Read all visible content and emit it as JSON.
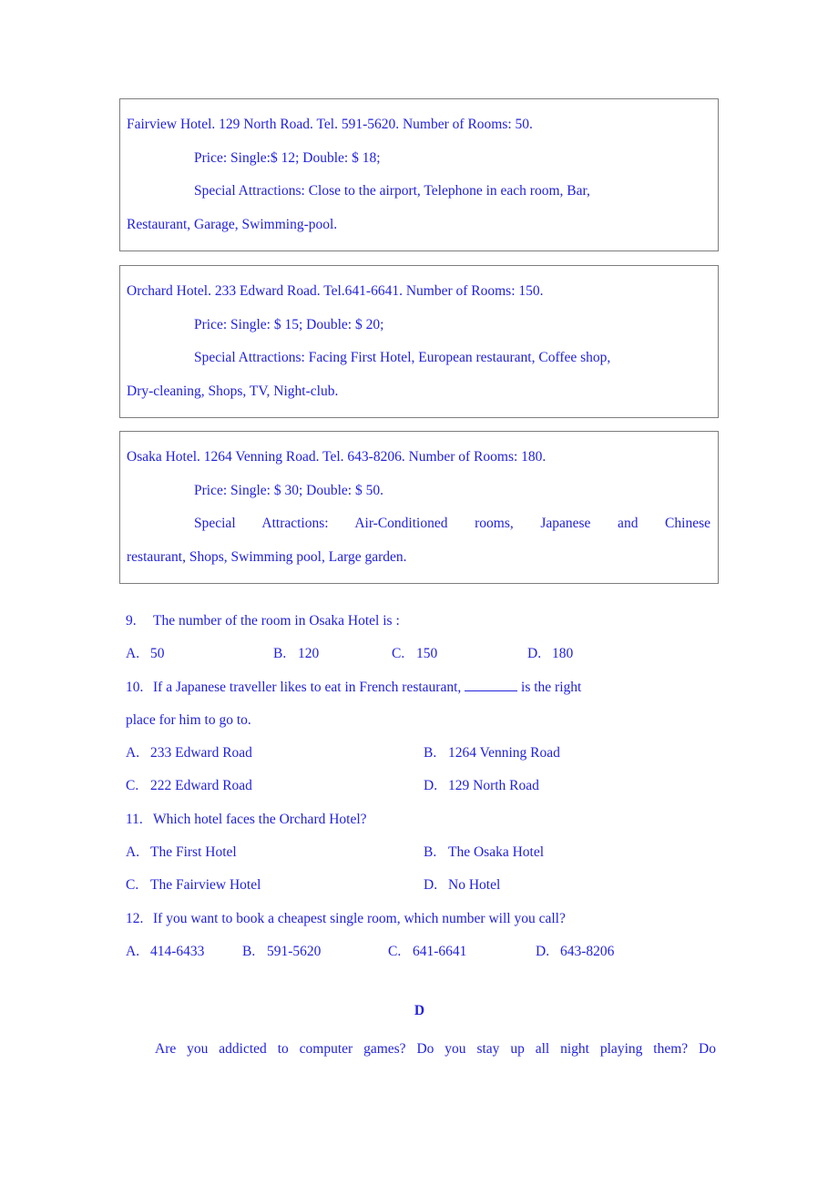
{
  "document": {
    "text_color": "#2222dd",
    "border_color": "#7d7d7d",
    "background": "#ffffff"
  },
  "hotel_boxes": [
    {
      "header": "Fairview Hotel. 129 North Road. Tel. 591-5620. Number of Rooms: 50.",
      "price_line": "Price:    Single:$ 12; Double: $ 18;",
      "attractions_head": "Special Attractions: Close to the airport, Telephone in each room, Bar,",
      "attractions_tail": "Restaurant, Garage, Swimming-pool."
    },
    {
      "header": "Orchard Hotel. 233 Edward Road. Tel.641-6641. Number of Rooms: 150.",
      "price_line": "Price:    Single: $ 15;  Double: $ 20;",
      "attractions_head": "Special Attractions: Facing First Hotel, European restaurant, Coffee shop,",
      "attractions_tail": "Dry-cleaning, Shops, TV, Night-club."
    },
    {
      "header": "Osaka Hotel. 1264 Venning Road. Tel. 643-8206. Number of Rooms: 180.",
      "price_line": "Price:    Single: $ 30;  Double: $ 50.",
      "attractions_head": "Special Attractions: Air-Conditioned rooms, Japanese and Chinese",
      "attractions_tail": "restaurant, Shops, Swimming pool, Large garden."
    }
  ],
  "questions": {
    "q9": {
      "number": "9.",
      "stem": "The number of the room in Osaka Hotel is :",
      "options": [
        {
          "label": "A.",
          "text": "50"
        },
        {
          "label": "B.",
          "text": "120"
        },
        {
          "label": "C.",
          "text": "150"
        },
        {
          "label": "D.",
          "text": "180"
        }
      ]
    },
    "q10": {
      "number": "10.",
      "stem_before_blank": "If a Japanese traveller likes to eat in French restaurant,",
      "stem_after_blank": "is the right",
      "stem_continued": "place for him to go to.",
      "options": [
        {
          "label": "A.",
          "text": "233 Edward Road"
        },
        {
          "label": "B.",
          "text": "1264 Venning Road"
        },
        {
          "label": "C.",
          "text": "222 Edward Road"
        },
        {
          "label": "D.",
          "text": "129 North Road"
        }
      ]
    },
    "q11": {
      "number": "11.",
      "stem": "Which hotel faces the Orchard Hotel?",
      "options": [
        {
          "label": "A.",
          "text": "The First Hotel"
        },
        {
          "label": "B.",
          "text": "The Osaka Hotel"
        },
        {
          "label": "C.",
          "text": "The Fairview Hotel"
        },
        {
          "label": "D.",
          "text": "No Hotel"
        }
      ]
    },
    "q12": {
      "number": "12.",
      "stem": "If you want to book a cheapest single room, which number will you call?",
      "options": [
        {
          "label": "A.",
          "text": "414-6433"
        },
        {
          "label": "B.",
          "text": "591-5620"
        },
        {
          "label": "C.",
          "text": "641-6641"
        },
        {
          "label": "D.",
          "text": "643-8206"
        }
      ]
    }
  },
  "section_d": {
    "heading": "D",
    "passage_line_1": "Are you addicted to computer games? Do you stay up all night playing them? Do"
  }
}
